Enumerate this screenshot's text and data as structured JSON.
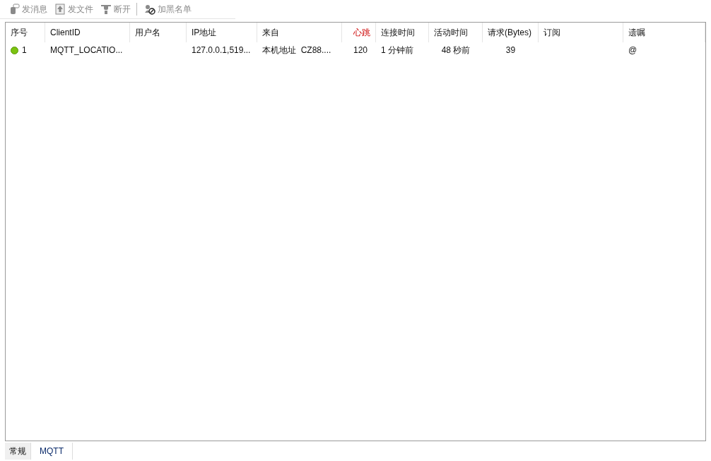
{
  "toolbar": [
    {
      "label": "发消息",
      "disabled": true
    },
    {
      "label": "发文件",
      "disabled": true
    },
    {
      "label": "断开",
      "disabled": true
    },
    {
      "label": "加黑名单",
      "disabled": true
    }
  ],
  "table": {
    "columns": [
      {
        "label": "序号",
        "highlight": false
      },
      {
        "label": "ClientID",
        "highlight": false
      },
      {
        "label": "用户名",
        "highlight": false
      },
      {
        "label": "IP地址",
        "highlight": false
      },
      {
        "label": "来自",
        "highlight": false
      },
      {
        "label": "心跳",
        "highlight": true
      },
      {
        "label": "连接时间",
        "highlight": false
      },
      {
        "label": "活动时间",
        "highlight": false
      },
      {
        "label": "请求(Bytes)",
        "highlight": false
      },
      {
        "label": "订阅",
        "highlight": false
      },
      {
        "label": "遗嘱",
        "highlight": false
      }
    ],
    "rows": [
      {
        "online": true,
        "cells": [
          "1",
          "MQTT_LOCATIO...",
          "",
          "127.0.0.1,519...",
          "本机地址  CZ88....",
          "120",
          "1 分钟前",
          "48 秒前",
          "39",
          "",
          "@"
        ]
      }
    ]
  },
  "tabs": [
    {
      "label": "常规",
      "selected": false
    },
    {
      "label": "MQTT",
      "selected": true
    }
  ]
}
